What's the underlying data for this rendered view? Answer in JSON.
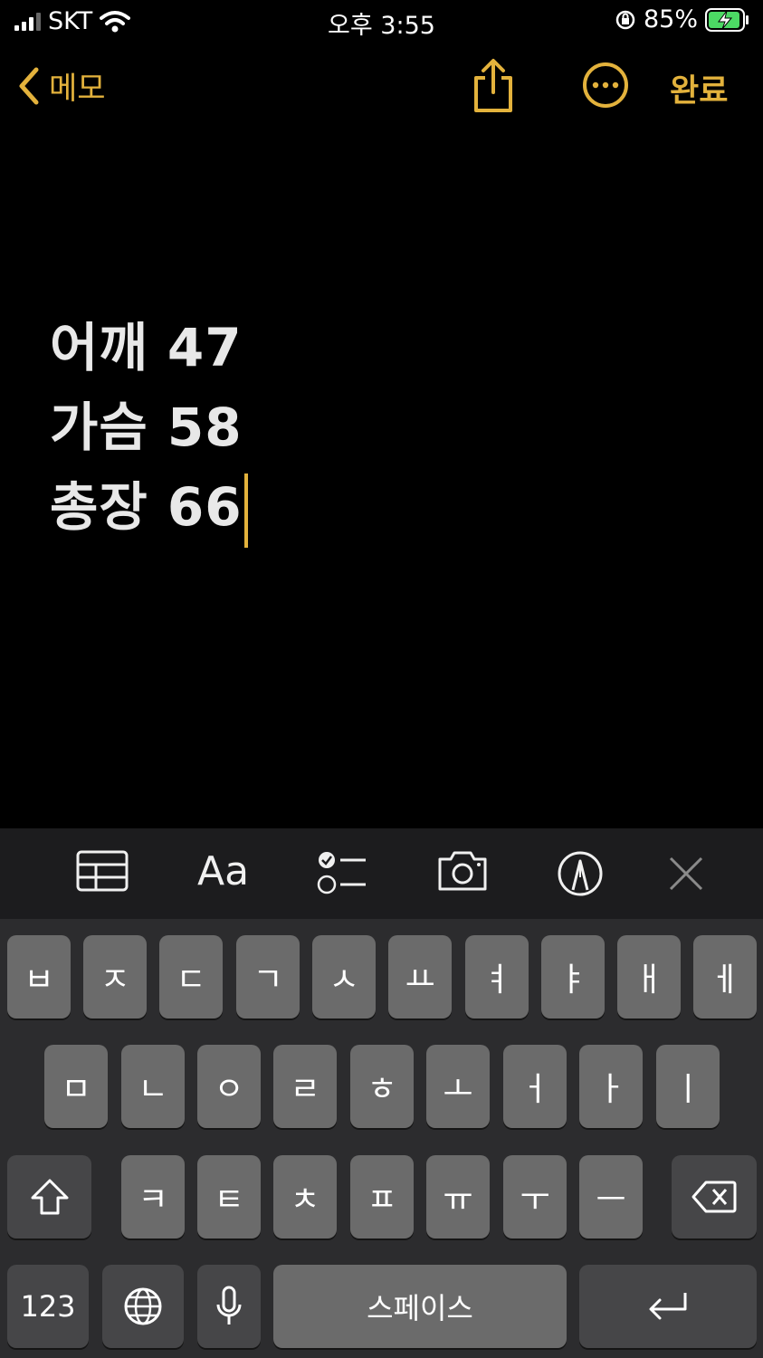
{
  "status_bar": {
    "carrier": "SKT",
    "time": "오후 3:55",
    "battery": "85%"
  },
  "nav": {
    "back_label": "메모",
    "done_label": "완료"
  },
  "note": {
    "lines": [
      "어깨 47",
      "가슴 58",
      "총장 66"
    ]
  },
  "toolbar": {
    "format_label": "Aa"
  },
  "keyboard": {
    "row1": [
      "ㅂ",
      "ㅈ",
      "ㄷ",
      "ㄱ",
      "ㅅ",
      "ㅛ",
      "ㅕ",
      "ㅑ",
      "ㅐ",
      "ㅔ"
    ],
    "row2": [
      "ㅁ",
      "ㄴ",
      "ㅇ",
      "ㄹ",
      "ㅎ",
      "ㅗ",
      "ㅓ",
      "ㅏ",
      "ㅣ"
    ],
    "row3": [
      "ㅋ",
      "ㅌ",
      "ㅊ",
      "ㅍ",
      "ㅠ",
      "ㅜ",
      "ㅡ"
    ],
    "numbers_label": "123",
    "space_label": "스페이스"
  },
  "colors": {
    "accent": "#e3b23c",
    "background": "#000000",
    "key": "#6b6b6b",
    "key_dark": "#464648"
  },
  "icons": [
    "wifi-icon",
    "orientation-lock-icon",
    "battery-charging-icon",
    "chevron-left-icon",
    "share-icon",
    "more-icon",
    "table-icon",
    "checklist-icon",
    "camera-icon",
    "markup-icon",
    "close-icon",
    "shift-icon",
    "delete-icon",
    "globe-icon",
    "microphone-icon",
    "return-icon"
  ]
}
